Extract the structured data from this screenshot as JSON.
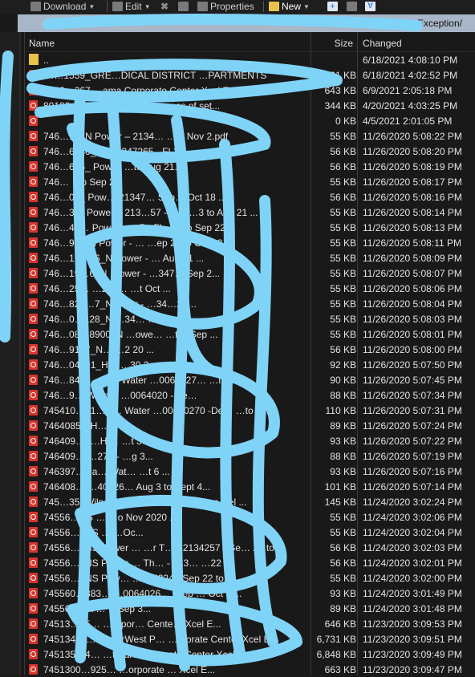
{
  "toolbar": {
    "download": "Download",
    "edit": "Edit",
    "properties": "Properties",
    "new": "New"
  },
  "path": {
    "visible_suffix": "Exception/"
  },
  "columns": {
    "name": "Name",
    "size": "Size",
    "changed": "Changed"
  },
  "parent": {
    "name": "..",
    "changed": "6/18/2021 4:08:10 PM"
  },
  "accent": {
    "scribble": "#7fd3f7",
    "pdf_icon": "#d9342b",
    "path_bar": "#a9b6c8"
  },
  "files": [
    {
      "name": "74…1559_GRE…DICAL DISTRICT …PARTMENTS",
      "size": "131 KB",
      "changed": "6/18/2021 4:02:52 PM"
    },
    {
      "name": "8202…267 …ama Corporate Center Xcel E...",
      "size": "643 KB",
      "changed": "6/9/2021 2:05:18 PM"
    },
    {
      "name": "80190…420 …igh Par… …ocess of set...",
      "size": "344 KB",
      "changed": "4/20/2021 4:03:25 PM"
    },
    {
      "name": "",
      "size": "0 KB",
      "changed": "4/5/2021 2:01:05 PM"
    },
    {
      "name": "746…12_N Power – 2134… …to Nov 2.pdf",
      "size": "55 KB",
      "changed": "11/26/2020 5:08:22 PM"
    },
    {
      "name": "746…6880_ … 21347265 - FL3 ...",
      "size": "56 KB",
      "changed": "11/26/2020 5:08:20 PM"
    },
    {
      "name": "746…695_ Pow… …to Aug 21...",
      "size": "56 KB",
      "changed": "11/26/2020 5:08:19 PM"
    },
    {
      "name": "746… …p Sep 2...",
      "size": "55 KB",
      "changed": "11/26/2020 5:08:17 PM"
    },
    {
      "name": "746…08_ Pow… 21347… Sep… Oct 18 ...",
      "size": "56 KB",
      "changed": "11/26/2020 5:08:16 PM"
    },
    {
      "name": "746…3… Power – 213…57 - FL2 …3 to Aug 21 ...",
      "size": "55 KB",
      "changed": "11/26/2020 5:08:14 PM"
    },
    {
      "name": "746…45… Power – …7 - FL… …o Sep 22...",
      "size": "55 KB",
      "changed": "11/26/2020 5:08:13 PM"
    },
    {
      "name": "746…92…N Power - … …ep 22 to Oct 23...",
      "size": "55 KB",
      "changed": "11/26/2020 5:08:11 PM"
    },
    {
      "name": "746…19…66_N Power - … Aug 21 ...",
      "size": "55 KB",
      "changed": "11/26/2020 5:08:09 PM"
    },
    {
      "name": "746…19…6_N …ower - …347… Sep 2...",
      "size": "55 KB",
      "changed": "11/26/2020 5:08:07 PM"
    },
    {
      "name": "746…25… …216… …t Oct ...",
      "size": "55 KB",
      "changed": "11/26/2020 5:08:06 PM"
    },
    {
      "name": "746…823…7_N …ver - …34…27…",
      "size": "55 KB",
      "changed": "11/26/2020 5:08:04 PM"
    },
    {
      "name": "746…0…128_N …34… …to Aug...",
      "size": "55 KB",
      "changed": "11/26/2020 5:08:03 PM"
    },
    {
      "name": "746…08…8900_N …owe… …t… Sep ...",
      "size": "55 KB",
      "changed": "11/26/2020 5:08:01 PM"
    },
    {
      "name": "746…9107_N… …2 20 ...",
      "size": "56 KB",
      "changed": "11/26/2020 5:08:00 PM"
    },
    {
      "name": "746…04891_H… …30 2...",
      "size": "92 KB",
      "changed": "11/26/2020 5:07:50 PM"
    },
    {
      "name": "746…8402…Hi… Water …0064027… …n 3...",
      "size": "90 KB",
      "changed": "11/26/2020 5:07:45 PM"
    },
    {
      "name": "746…9… Water - …0064020 - Fe…",
      "size": "88 KB",
      "changed": "11/26/2020 5:07:34 PM"
    },
    {
      "name": "745410…21…H… Water …00640270 -De… …to J...",
      "size": "110 KB",
      "changed": "11/26/2020 5:07:31 PM"
    },
    {
      "name": "7464085…H…",
      "size": "89 KB",
      "changed": "11/26/2020 5:07:24 PM"
    },
    {
      "name": "746409…9…Hi… …t 30 ...",
      "size": "93 KB",
      "changed": "11/26/2020 5:07:22 PM"
    },
    {
      "name": "746409… …270 - …g 3...",
      "size": "88 KB",
      "changed": "11/26/2020 5:07:19 PM"
    },
    {
      "name": "746397…Ha… Wat… …t 6 ...",
      "size": "93 KB",
      "changed": "11/26/2020 5:07:16 PM"
    },
    {
      "name": "746408…  …40026… Aug 3 to Sept 4...",
      "size": "101 KB",
      "changed": "11/26/2020 5:07:14 PM"
    },
    {
      "name": "745…35_Wils… Fue… …218… Propane Del ...",
      "size": "145 KB",
      "changed": "11/24/2020 3:02:24 PM"
    },
    {
      "name": "74556…NS … …o Nov 2020 ...",
      "size": "55 KB",
      "changed": "11/24/2020 3:02:06 PM"
    },
    {
      "name": "74556…_NS … …Oc...",
      "size": "55 KB",
      "changed": "11/24/2020 3:02:04 PM"
    },
    {
      "name": "74556…_NS Power … …r T… - 2134257 - Se… 22 to...",
      "size": "56 KB",
      "changed": "11/24/2020 3:02:03 PM"
    },
    {
      "name": "74556…_NS Power … Th… - 213… …22 t...",
      "size": "56 KB",
      "changed": "11/24/2020 3:02:01 PM"
    },
    {
      "name": "74556…_NS Pow… …134224 - Sep 22 to...",
      "size": "55 KB",
      "changed": "11/24/2020 3:02:00 PM"
    },
    {
      "name": "745560…883… …0064026… …ep … Oct 6 ...",
      "size": "93 KB",
      "changed": "11/24/2020 3:01:49 PM"
    },
    {
      "name": "745560…47… …Sep 3...",
      "size": "89 KB",
      "changed": "11/24/2020 3:01:48 PM"
    },
    {
      "name": "74513…65… …orpor… Cente… Xcel E...",
      "size": "646 KB",
      "changed": "11/23/2020 3:09:53 PM"
    },
    {
      "name": "74513400…65…erWest P… …rporate Center Xcel E...",
      "size": "6,731 KB",
      "changed": "11/23/2020 3:09:51 PM"
    },
    {
      "name": "745135…4… …t Par… …porate Center Xcel E...",
      "size": "6,848 KB",
      "changed": "11/23/2020 3:09:49 PM"
    },
    {
      "name": "7451300…925… …orporate … Xcel E...",
      "size": "663 KB",
      "changed": "11/23/2020 3:09:47 PM"
    }
  ]
}
